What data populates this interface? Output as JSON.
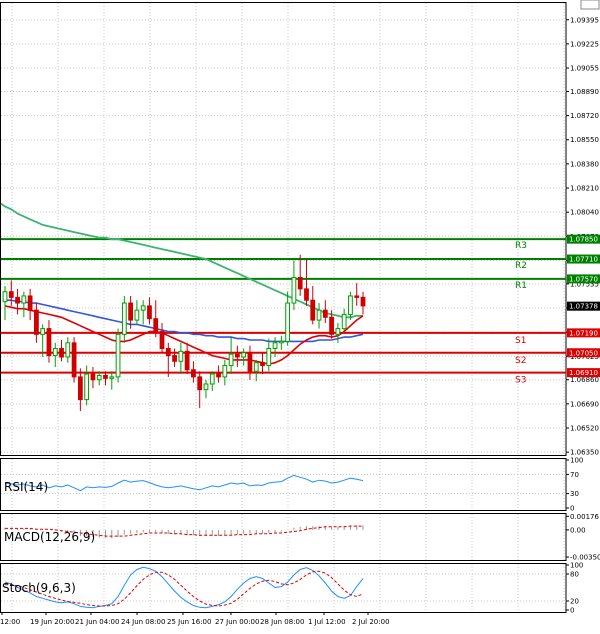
{
  "chart_data": {
    "type": "candlestick",
    "instrument_hint": "",
    "time_labels": [
      "12:00",
      "19 Jun 20:00",
      "21 Jun 04:00",
      "24 Jun 08:00",
      "25 Jun 16:00",
      "27 Jun 00:00",
      "28 Jun 08:00",
      "1 Jul 12:00",
      "2 Jul 20:00"
    ],
    "price_axis": {
      "labels": [
        "1.09395",
        "1.09225",
        "1.09055",
        "1.08890",
        "1.08720",
        "1.08550",
        "1.08380",
        "1.08210",
        "1.08040",
        "1.07870",
        "1.07700",
        "1.07535",
        "1.07365",
        "1.07195",
        "1.07025",
        "1.06860",
        "1.06690",
        "1.06520",
        "1.06350"
      ],
      "ylim": [
        1.0633,
        1.0952
      ]
    },
    "current_price": {
      "value": 1.07378,
      "label": "1.07378",
      "color": "#000000"
    },
    "levels": [
      {
        "name": "R3",
        "value": 1.0785,
        "label": "1.07850",
        "color": "#008000"
      },
      {
        "name": "R2",
        "value": 1.0771,
        "label": "1.07710",
        "color": "#008000"
      },
      {
        "name": "R1",
        "value": 1.0757,
        "label": "1.07570",
        "color": "#008000"
      },
      {
        "name": "S1",
        "value": 1.0719,
        "label": "1.07190",
        "color": "#dd0000"
      },
      {
        "name": "S2",
        "value": 1.0705,
        "label": "1.07050",
        "color": "#dd0000"
      },
      {
        "name": "S3",
        "value": 1.0691,
        "label": "1.06910",
        "color": "#dd0000"
      }
    ],
    "candles": [
      [
        1.0741,
        1.0752,
        1.0728,
        1.0748
      ],
      [
        1.0748,
        1.0756,
        1.0738,
        1.0744
      ],
      [
        1.0744,
        1.075,
        1.0732,
        1.074
      ],
      [
        1.074,
        1.0748,
        1.073,
        1.0745
      ],
      [
        1.0745,
        1.075,
        1.0728,
        1.0735
      ],
      [
        1.0735,
        1.074,
        1.0712,
        1.0718
      ],
      [
        1.0718,
        1.0725,
        1.0702,
        1.0722
      ],
      [
        1.0722,
        1.0728,
        1.0698,
        1.0703
      ],
      [
        1.0703,
        1.0712,
        1.0695,
        1.0708
      ],
      [
        1.0708,
        1.0714,
        1.0699,
        1.0702
      ],
      [
        1.0702,
        1.0716,
        1.0698,
        1.0712
      ],
      [
        1.0712,
        1.0716,
        1.0684,
        1.0688
      ],
      [
        1.0688,
        1.0694,
        1.0664,
        1.0672
      ],
      [
        1.0672,
        1.0696,
        1.0668,
        1.069
      ],
      [
        1.069,
        1.0695,
        1.068,
        1.0686
      ],
      [
        1.0686,
        1.0692,
        1.0682,
        1.0689
      ],
      [
        1.0689,
        1.0692,
        1.0682,
        1.0687
      ],
      [
        1.0687,
        1.0692,
        1.0679,
        1.0688
      ],
      [
        1.0688,
        1.0722,
        1.0684,
        1.0718
      ],
      [
        1.0718,
        1.0745,
        1.0712,
        1.074
      ],
      [
        1.074,
        1.0745,
        1.0722,
        1.0728
      ],
      [
        1.0728,
        1.0742,
        1.0725,
        1.0735
      ],
      [
        1.0735,
        1.0742,
        1.0725,
        1.0738
      ],
      [
        1.0738,
        1.0744,
        1.0725,
        1.0729
      ],
      [
        1.0729,
        1.0742,
        1.0716,
        1.072
      ],
      [
        1.072,
        1.0726,
        1.0705,
        1.0708
      ],
      [
        1.0708,
        1.0712,
        1.0688,
        1.0703
      ],
      [
        1.0703,
        1.0708,
        1.0695,
        1.0699
      ],
      [
        1.0699,
        1.0712,
        1.069,
        1.0706
      ],
      [
        1.0706,
        1.0712,
        1.069,
        1.0693
      ],
      [
        1.0693,
        1.0699,
        1.0684,
        1.0688
      ],
      [
        1.0688,
        1.0692,
        1.0666,
        1.0679
      ],
      [
        1.0679,
        1.0686,
        1.0673,
        1.0683
      ],
      [
        1.0683,
        1.0692,
        1.0678,
        1.069
      ],
      [
        1.069,
        1.0696,
        1.0684,
        1.0688
      ],
      [
        1.0688,
        1.07,
        1.0682,
        1.0696
      ],
      [
        1.0696,
        1.0716,
        1.069,
        1.0704
      ],
      [
        1.0704,
        1.071,
        1.0695,
        1.0702
      ],
      [
        1.0702,
        1.0708,
        1.0696,
        1.0705
      ],
      [
        1.0705,
        1.071,
        1.0686,
        1.0692
      ],
      [
        1.0692,
        1.07,
        1.0685,
        1.0698
      ],
      [
        1.0698,
        1.0705,
        1.069,
        1.0696
      ],
      [
        1.0696,
        1.0715,
        1.0692,
        1.0708
      ],
      [
        1.0708,
        1.0716,
        1.0702,
        1.0712
      ],
      [
        1.0712,
        1.0717,
        1.0707,
        1.0713
      ],
      [
        1.0713,
        1.0748,
        1.071,
        1.074
      ],
      [
        1.074,
        1.077,
        1.0735,
        1.0758
      ],
      [
        1.0758,
        1.0774,
        1.0745,
        1.075
      ],
      [
        1.075,
        1.0771,
        1.0738,
        1.0742
      ],
      [
        1.0742,
        1.0752,
        1.0725,
        1.0728
      ],
      [
        1.0728,
        1.074,
        1.0722,
        1.0735
      ],
      [
        1.0735,
        1.0742,
        1.0726,
        1.073
      ],
      [
        1.073,
        1.0735,
        1.0715,
        1.0718
      ],
      [
        1.0718,
        1.0726,
        1.0712,
        1.0722
      ],
      [
        1.0722,
        1.0736,
        1.072,
        1.0732
      ],
      [
        1.0732,
        1.0748,
        1.0728,
        1.0745
      ],
      [
        1.0745,
        1.0754,
        1.0738,
        1.0744
      ],
      [
        1.0744,
        1.0748,
        1.0732,
        1.0738
      ]
    ],
    "ma_green": [
      1.0808,
      1.0806,
      1.0803,
      1.0801,
      1.0799,
      1.0797,
      1.0795,
      1.0794,
      1.0793,
      1.0792,
      1.0791,
      1.079,
      1.0789,
      1.0788,
      1.0787,
      1.0786,
      1.0786,
      1.0785,
      1.0785,
      1.0784,
      1.0783,
      1.0782,
      1.0781,
      1.078,
      1.0779,
      1.0778,
      1.0777,
      1.0776,
      1.0775,
      1.0774,
      1.0773,
      1.0772,
      1.0771,
      1.0769,
      1.0767,
      1.0765,
      1.0763,
      1.0761,
      1.0759,
      1.0757,
      1.0755,
      1.0753,
      1.0751,
      1.0749,
      1.0747,
      1.0745,
      1.0743,
      1.0741,
      1.0739,
      1.0737,
      1.0735,
      1.0733,
      1.0732,
      1.0731,
      1.073,
      1.073,
      1.0731,
      1.0731
    ],
    "ma_blue": [
      1.0742,
      1.0742,
      1.0741,
      1.0741,
      1.074,
      1.074,
      1.0739,
      1.0738,
      1.0737,
      1.0736,
      1.0735,
      1.0734,
      1.0733,
      1.0732,
      1.0731,
      1.073,
      1.0729,
      1.0728,
      1.0727,
      1.0726,
      1.0725,
      1.0725,
      1.0724,
      1.0723,
      1.0722,
      1.0721,
      1.072,
      1.072,
      1.0719,
      1.0719,
      1.0718,
      1.0718,
      1.0717,
      1.0717,
      1.0716,
      1.0716,
      1.0716,
      1.0715,
      1.0715,
      1.0714,
      1.0714,
      1.0714,
      1.0713,
      1.0713,
      1.0713,
      1.0713,
      1.0713,
      1.0713,
      1.0713,
      1.0713,
      1.0714,
      1.0714,
      1.0714,
      1.0715,
      1.0716,
      1.0716,
      1.0717,
      1.0718
    ],
    "ma_red": [
      1.0738,
      1.0737,
      1.0736,
      1.0736,
      1.0735,
      1.0734,
      1.0733,
      1.0732,
      1.0731,
      1.073,
      1.0728,
      1.0726,
      1.0724,
      1.0722,
      1.072,
      1.0718,
      1.0716,
      1.0714,
      1.0713,
      1.0713,
      1.0714,
      1.0716,
      1.0718,
      1.072,
      1.072,
      1.0719,
      1.0717,
      1.0715,
      1.0713,
      1.0711,
      1.0709,
      1.0707,
      1.0705,
      1.0703,
      1.0702,
      1.0701,
      1.07,
      1.07,
      1.07,
      1.07,
      1.0699,
      1.0698,
      1.0697,
      1.0698,
      1.07,
      1.0703,
      1.0707,
      1.0711,
      1.0714,
      1.0716,
      1.0717,
      1.0717,
      1.0716,
      1.0717,
      1.072,
      1.0724,
      1.0728,
      1.0731
    ],
    "rsi": {
      "label": "RSI(14)",
      "axis_labels": [
        "100",
        "70",
        "30",
        "0"
      ],
      "ylim": [
        0,
        100
      ],
      "color": "#1e90ff",
      "values": [
        52,
        50,
        48,
        50,
        46,
        44,
        48,
        42,
        46,
        44,
        48,
        42,
        36,
        44,
        42,
        44,
        43,
        45,
        52,
        58,
        54,
        56,
        57,
        53,
        48,
        44,
        42,
        44,
        46,
        43,
        40,
        38,
        42,
        46,
        44,
        48,
        52,
        50,
        52,
        46,
        48,
        47,
        52,
        54,
        55,
        62,
        68,
        64,
        60,
        54,
        58,
        56,
        52,
        54,
        58,
        62,
        60,
        57
      ]
    },
    "macd": {
      "label": "MACD(12,26,9)",
      "axis_labels": [
        "0.00176",
        "0.00",
        "-0.003505"
      ],
      "ylim": [
        -0.0035,
        0.0018
      ],
      "hist_color": "#999999",
      "signal_color": "#dd0000",
      "histogram": [
        0.0003,
        0.0003,
        0.0002,
        0.0002,
        0.0002,
        0.0001,
        0.0001,
        0.0,
        -0.0001,
        -0.0002,
        -0.0003,
        -0.0005,
        -0.0008,
        -0.0008,
        -0.0009,
        -0.001,
        -0.001,
        -0.0011,
        -0.0009,
        -0.0006,
        -0.0005,
        -0.0004,
        -0.0003,
        -0.0003,
        -0.0003,
        -0.0004,
        -0.0005,
        -0.0006,
        -0.0006,
        -0.0007,
        -0.0007,
        -0.0008,
        -0.0008,
        -0.0008,
        -0.0008,
        -0.0007,
        -0.0006,
        -0.0006,
        -0.0005,
        -0.0005,
        -0.0005,
        -0.0005,
        -0.0004,
        -0.0003,
        -0.0002,
        0.0,
        0.0003,
        0.0004,
        0.0005,
        0.0005,
        0.0005,
        0.0005,
        0.0004,
        0.0004,
        0.0005,
        0.0006,
        0.0006,
        0.0006
      ],
      "signal": [
        0.0002,
        0.0002,
        0.0002,
        0.0002,
        0.0002,
        0.0001,
        0.0001,
        0.0001,
        0.0,
        -0.0001,
        -0.0002,
        -0.0003,
        -0.0004,
        -0.0005,
        -0.0006,
        -0.0007,
        -0.0008,
        -0.0008,
        -0.0008,
        -0.0008,
        -0.0007,
        -0.0006,
        -0.0005,
        -0.0004,
        -0.0004,
        -0.0004,
        -0.0004,
        -0.0005,
        -0.0005,
        -0.0006,
        -0.0006,
        -0.0007,
        -0.0007,
        -0.0007,
        -0.0007,
        -0.0007,
        -0.0007,
        -0.0006,
        -0.0006,
        -0.0006,
        -0.0005,
        -0.0005,
        -0.0005,
        -0.0004,
        -0.0004,
        -0.0003,
        -0.0002,
        -0.0001,
        0.0001,
        0.0002,
        0.0003,
        0.0004,
        0.0004,
        0.0004,
        0.0004,
        0.0005,
        0.0005,
        0.0005
      ]
    },
    "stoch": {
      "label": "Stoch(9,6,3)",
      "axis_labels": [
        "100",
        "80",
        "20",
        "0"
      ],
      "ylim": [
        0,
        100
      ],
      "main_color": "#1e90ff",
      "signal_color": "#dd0000",
      "main": [
        62,
        58,
        50,
        44,
        38,
        30,
        26,
        22,
        18,
        16,
        18,
        14,
        8,
        6,
        5,
        8,
        10,
        14,
        30,
        55,
        78,
        90,
        95,
        92,
        86,
        74,
        58,
        42,
        28,
        18,
        10,
        6,
        5,
        8,
        12,
        18,
        30,
        46,
        60,
        70,
        74,
        70,
        60,
        50,
        52,
        62,
        78,
        90,
        94,
        88,
        76,
        60,
        42,
        30,
        26,
        32,
        52,
        70
      ],
      "signal": [
        56,
        56,
        54,
        50,
        45,
        40,
        35,
        30,
        26,
        22,
        19,
        17,
        15,
        12,
        10,
        9,
        9,
        10,
        14,
        24,
        38,
        54,
        68,
        78,
        84,
        84,
        78,
        68,
        55,
        42,
        30,
        20,
        13,
        10,
        9,
        11,
        15,
        24,
        36,
        48,
        58,
        64,
        66,
        63,
        58,
        56,
        60,
        68,
        78,
        85,
        86,
        82,
        72,
        58,
        44,
        34,
        30,
        36
      ]
    }
  }
}
